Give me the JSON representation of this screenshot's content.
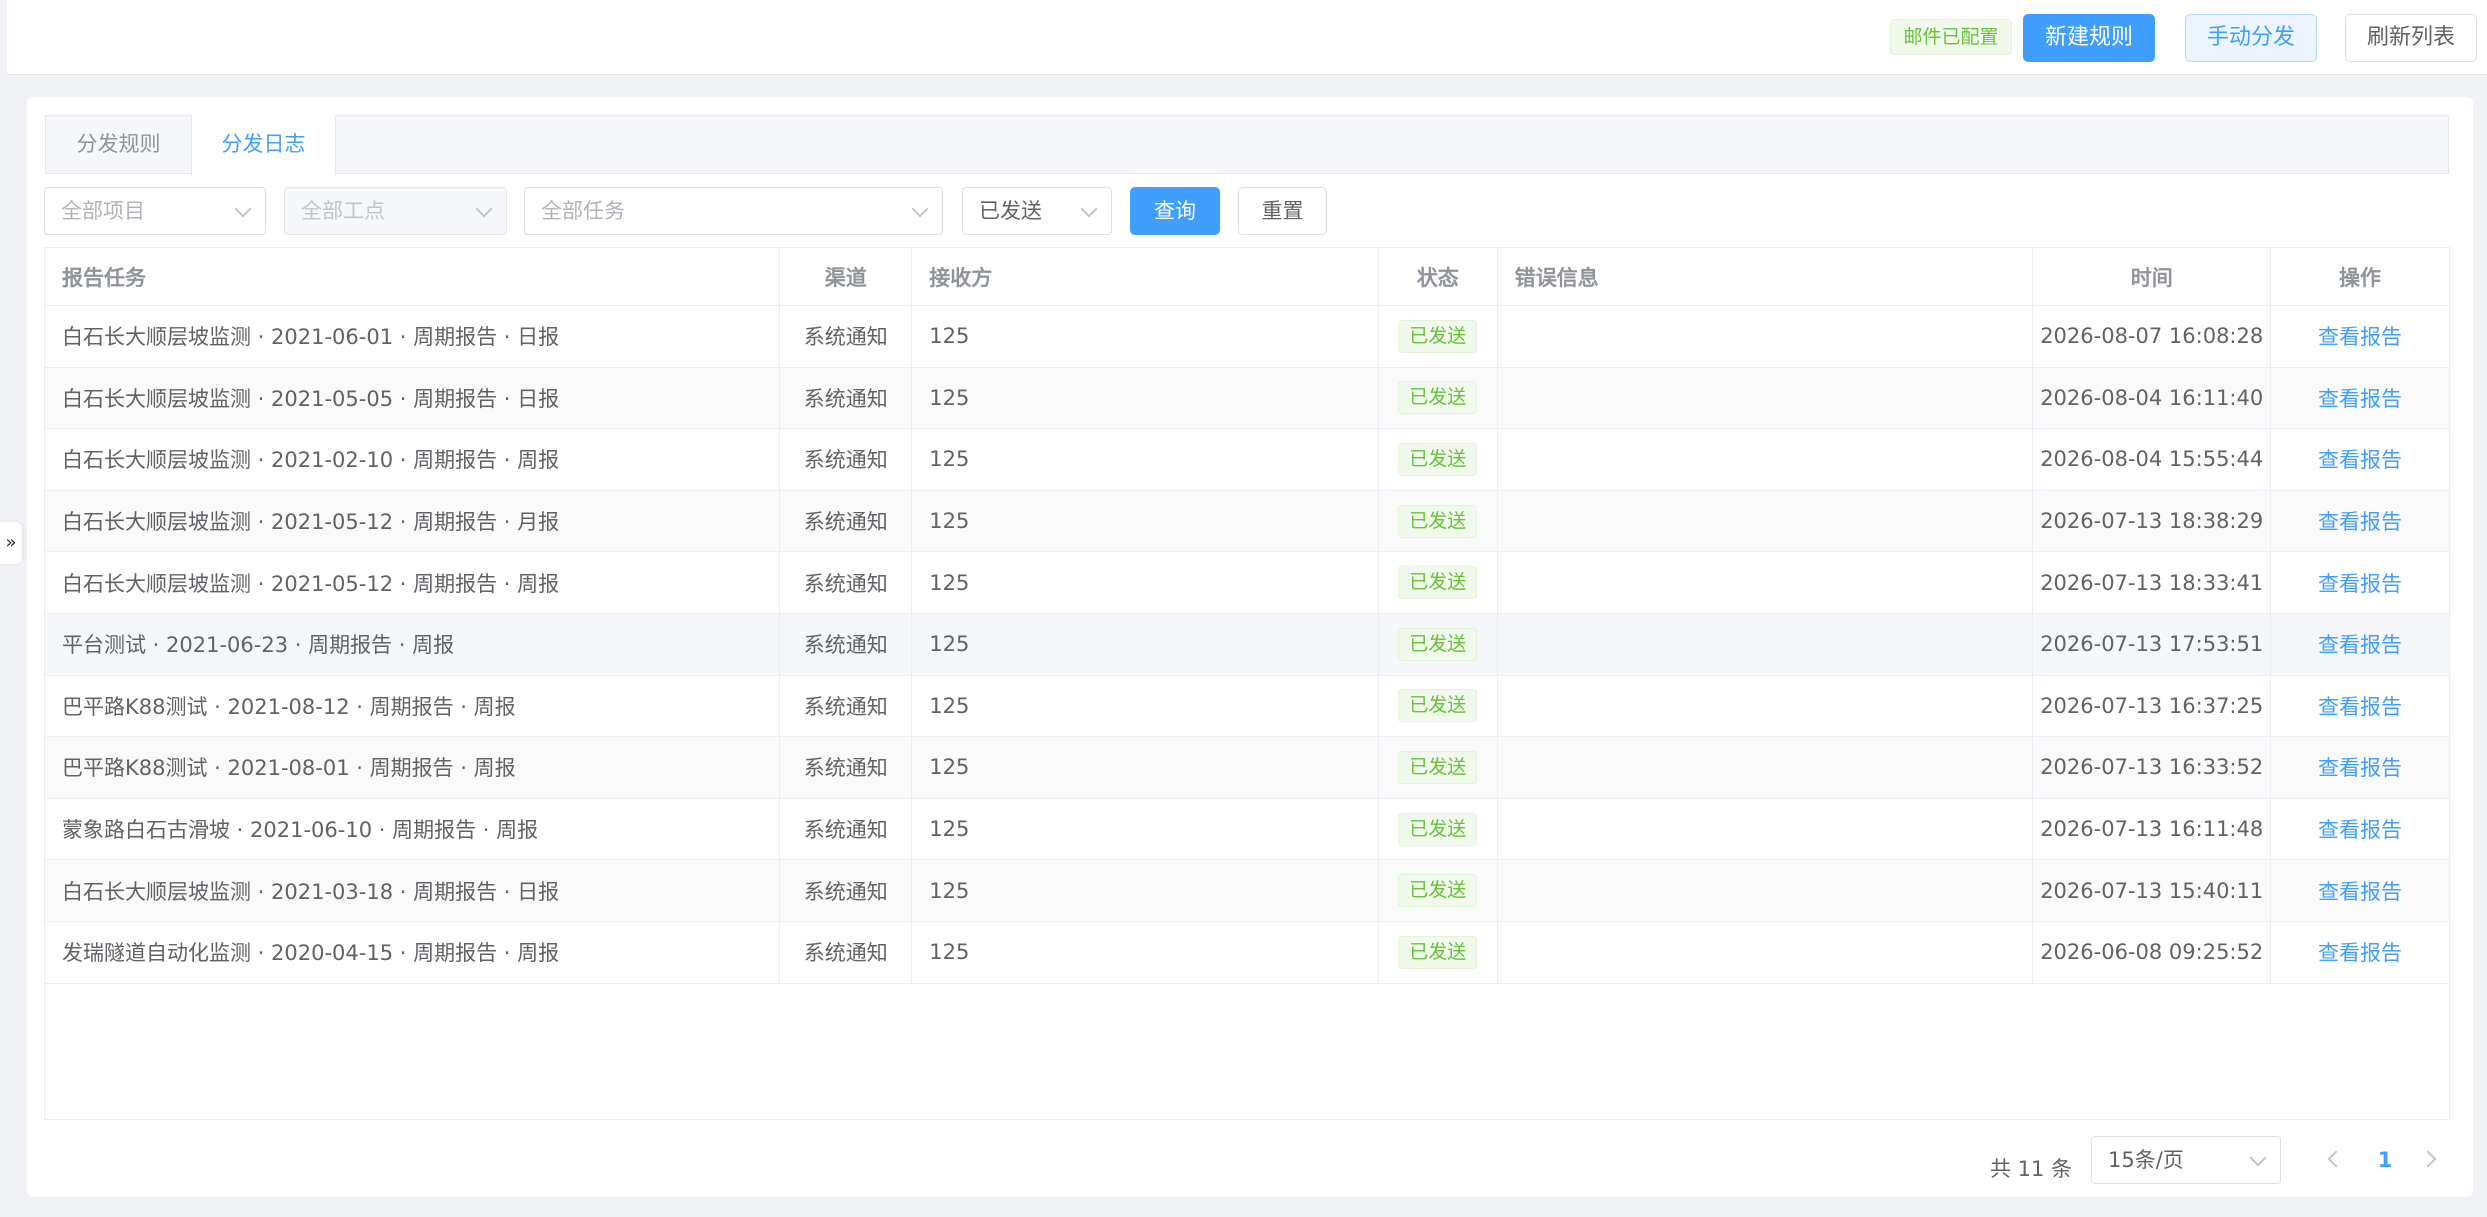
{
  "topbar": {
    "mail_badge": "邮件已配置",
    "new_rule": "新建规则",
    "manual_dispatch": "手动分发",
    "refresh_list": "刷新列表"
  },
  "side_toggle": "»",
  "tabs": [
    {
      "label": "分发规则",
      "active": false
    },
    {
      "label": "分发日志",
      "active": true
    }
  ],
  "filters": {
    "project_placeholder": "全部项目",
    "site_placeholder": "全部工点",
    "task_placeholder": "全部任务",
    "status_value": "已发送",
    "query": "查询",
    "reset": "重置"
  },
  "table": {
    "headers": {
      "task": "报告任务",
      "channel": "渠道",
      "receiver": "接收方",
      "status": "状态",
      "error": "错误信息",
      "time": "时间",
      "action": "操作"
    },
    "rows": [
      {
        "task": "白石长大顺层坡监测 · 2021-06-01 · 周期报告 · 日报",
        "channel": "系统通知",
        "receiver": "125",
        "status": "已发送",
        "error": "",
        "time": "2026-08-07 16:08:28",
        "action": "查看报告"
      },
      {
        "task": "白石长大顺层坡监测 · 2021-05-05 · 周期报告 · 日报",
        "channel": "系统通知",
        "receiver": "125",
        "status": "已发送",
        "error": "",
        "time": "2026-08-04 16:11:40",
        "action": "查看报告"
      },
      {
        "task": "白石长大顺层坡监测 · 2021-02-10 · 周期报告 · 周报",
        "channel": "系统通知",
        "receiver": "125",
        "status": "已发送",
        "error": "",
        "time": "2026-08-04 15:55:44",
        "action": "查看报告"
      },
      {
        "task": "白石长大顺层坡监测 · 2021-05-12 · 周期报告 · 月报",
        "channel": "系统通知",
        "receiver": "125",
        "status": "已发送",
        "error": "",
        "time": "2026-07-13 18:38:29",
        "action": "查看报告"
      },
      {
        "task": "白石长大顺层坡监测 · 2021-05-12 · 周期报告 · 周报",
        "channel": "系统通知",
        "receiver": "125",
        "status": "已发送",
        "error": "",
        "time": "2026-07-13 18:33:41",
        "action": "查看报告"
      },
      {
        "task": "平台测试 · 2021-06-23 · 周期报告 · 周报",
        "channel": "系统通知",
        "receiver": "125",
        "status": "已发送",
        "error": "",
        "time": "2026-07-13 17:53:51",
        "action": "查看报告"
      },
      {
        "task": "巴平路K88测试 · 2021-08-12 · 周期报告 · 周报",
        "channel": "系统通知",
        "receiver": "125",
        "status": "已发送",
        "error": "",
        "time": "2026-07-13 16:37:25",
        "action": "查看报告"
      },
      {
        "task": "巴平路K88测试 · 2021-08-01 · 周期报告 · 周报",
        "channel": "系统通知",
        "receiver": "125",
        "status": "已发送",
        "error": "",
        "time": "2026-07-13 16:33:52",
        "action": "查看报告"
      },
      {
        "task": "蒙象路白石古滑坡 · 2021-06-10 · 周期报告 · 周报",
        "channel": "系统通知",
        "receiver": "125",
        "status": "已发送",
        "error": "",
        "time": "2026-07-13 16:11:48",
        "action": "查看报告"
      },
      {
        "task": "白石长大顺层坡监测 · 2021-03-18 · 周期报告 · 日报",
        "channel": "系统通知",
        "receiver": "125",
        "status": "已发送",
        "error": "",
        "time": "2026-07-13 15:40:11",
        "action": "查看报告"
      },
      {
        "task": "发瑞隧道自动化监测 · 2020-04-15 · 周期报告 · 周报",
        "channel": "系统通知",
        "receiver": "125",
        "status": "已发送",
        "error": "",
        "time": "2026-06-08 09:25:52",
        "action": "查看报告"
      }
    ]
  },
  "pagination": {
    "total_text": "共 11 条",
    "page_size": "15条/页",
    "current_page": "1"
  },
  "colors": {
    "primary": "#409eff",
    "success": "#67c23a",
    "background": "#f0f2f5"
  }
}
